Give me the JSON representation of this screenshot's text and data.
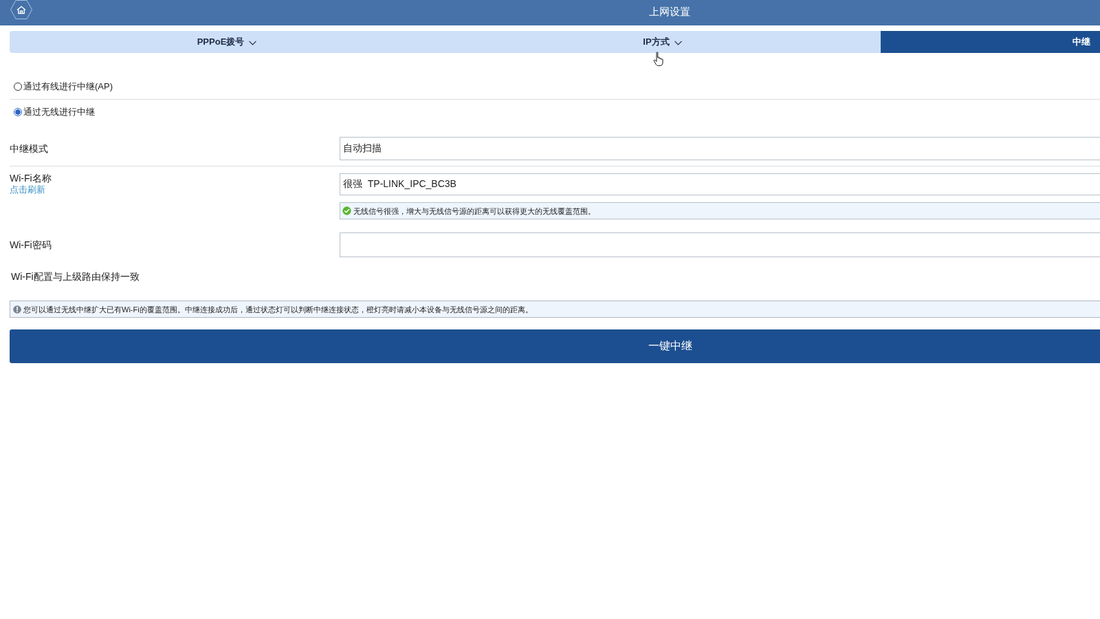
{
  "header": {
    "title": "上网设置"
  },
  "tabs": [
    {
      "label": "PPPoE拨号",
      "selected": false,
      "dropdown": true
    },
    {
      "label": "IP方式",
      "selected": false,
      "dropdown": true
    },
    {
      "label": "中继",
      "selected": true,
      "dropdown": false
    }
  ],
  "relay_options": [
    {
      "label": "通过有线进行中继(AP)",
      "selected": false
    },
    {
      "label": "通过无线进行中继",
      "selected": true
    }
  ],
  "relay_mode": {
    "label": "中继模式",
    "value": "自动扫描"
  },
  "wifi_name": {
    "label": "Wi-Fi名称",
    "refresh_link": "点击刷新",
    "value": "很强  TP-LINK_IPC_BC3B",
    "hint": "无线信号很强，增大与无线信号源的距离可以获得更大的无线覆盖范围。"
  },
  "wifi_password": {
    "label": "Wi-Fi密码"
  },
  "note": "Wi-Fi配置与上级路由保持一致",
  "info": "您可以通过无线中继扩大已有Wi-Fi的覆盖范围。中继连接成功后，通过状态灯可以判断中继连接状态，橙灯亮时请减小本设备与无线信号源之间的距离。",
  "submit_button": "一键中继"
}
